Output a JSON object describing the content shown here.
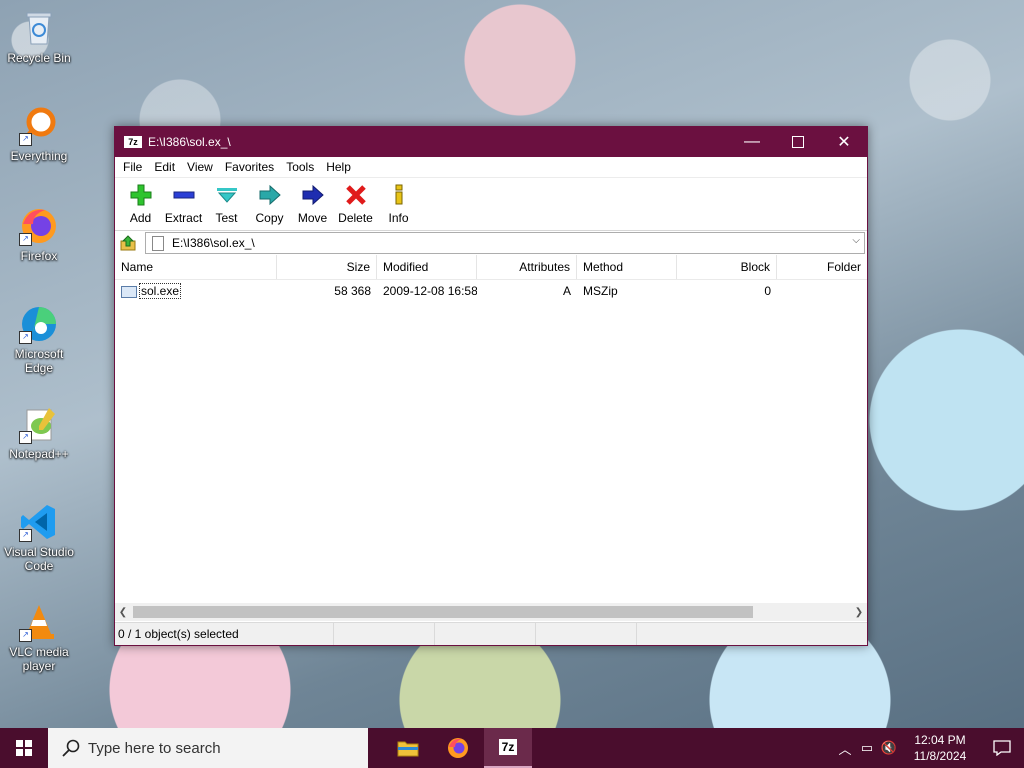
{
  "desktop": {
    "icons": [
      {
        "label": "Recycle Bin"
      },
      {
        "label": "Everything"
      },
      {
        "label": "Firefox"
      },
      {
        "label": "Microsoft Edge"
      },
      {
        "label": "Notepad++"
      },
      {
        "label": "Visual Studio Code"
      },
      {
        "label": "VLC media player"
      }
    ]
  },
  "window": {
    "app_badge": "7z",
    "title": "E:\\I386\\sol.ex_\\",
    "menu": [
      "File",
      "Edit",
      "View",
      "Favorites",
      "Tools",
      "Help"
    ],
    "toolbar": [
      "Add",
      "Extract",
      "Test",
      "Copy",
      "Move",
      "Delete",
      "Info"
    ],
    "address": "E:\\I386\\sol.ex_\\",
    "columns": [
      "Name",
      "Size",
      "Modified",
      "Attributes",
      "Method",
      "Block",
      "Folder"
    ],
    "rows": [
      {
        "name": "sol.exe",
        "size": "58 368",
        "modified": "2009-12-08 16:58",
        "attributes": "A",
        "method": "MSZip",
        "block": "0",
        "folder": ""
      }
    ],
    "status": {
      "selection": "0 / 1 object(s) selected",
      "cell2": "",
      "cell3": "",
      "cell4": ""
    }
  },
  "taskbar": {
    "search_placeholder": "Type here to search",
    "apps": [
      "File Explorer",
      "Firefox",
      "7-Zip"
    ],
    "time": "12:04 PM",
    "date": "11/8/2024",
    "badge_7z": "7z"
  },
  "colors": {
    "titlebar": "#6b1040",
    "taskbar": "#4a0d2d"
  }
}
